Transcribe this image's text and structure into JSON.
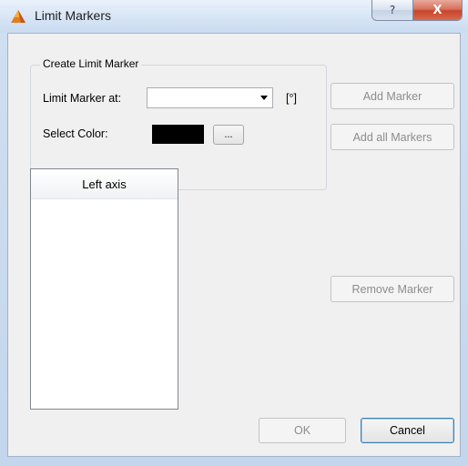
{
  "window": {
    "title": "Limit Markers",
    "help_glyph": "?",
    "close_glyph": "X"
  },
  "create_group": {
    "title": "Create Limit Marker",
    "limit_label": "Limit Marker at:",
    "limit_value": "",
    "unit": "[°]",
    "color_label": "Select Color:",
    "color_value": "#000000",
    "color_button": "..."
  },
  "buttons": {
    "add_marker": "Add Marker",
    "add_all_markers": "Add all Markers",
    "remove_marker": "Remove Marker",
    "ok": "OK",
    "cancel": "Cancel"
  },
  "list": {
    "header": "Left axis",
    "items": []
  },
  "icons": {
    "app": "matlab-logo-icon",
    "dropdown": "chevron-down-icon"
  }
}
